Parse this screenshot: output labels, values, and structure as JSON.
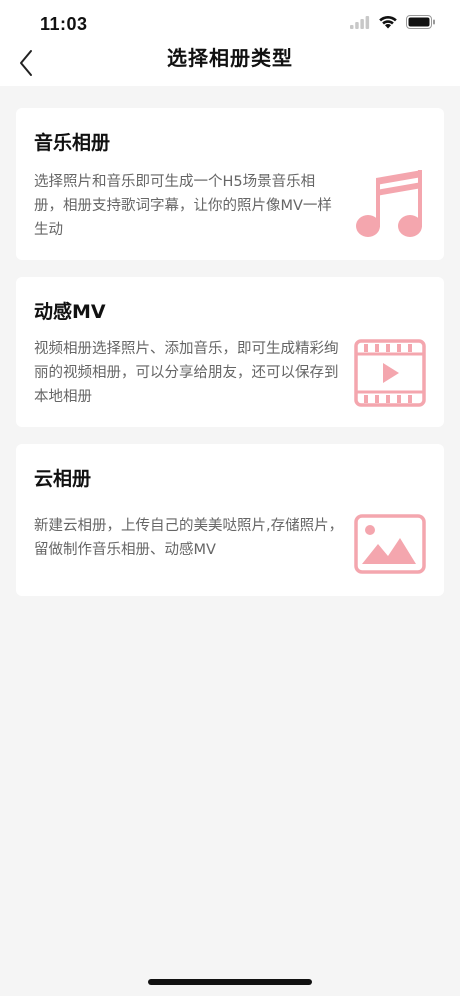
{
  "status_bar": {
    "time": "11:03"
  },
  "nav": {
    "title": "选择相册类型"
  },
  "cards": [
    {
      "title": "音乐相册",
      "description": "选择照片和音乐即可生成一个H5场景音乐相册，相册支持歌词字幕，让你的照片像MV一样生动",
      "icon": "music-note-icon"
    },
    {
      "title": "动感MV",
      "description": "视频相册选择照片、添加音乐，即可生成精彩绚丽的视频相册，可以分享给朋友，还可以保存到本地相册",
      "icon": "video-film-icon"
    },
    {
      "title": "云相册",
      "description": "新建云相册，上传自己的美美哒照片,存储照片，留做制作音乐相册、动感MV",
      "icon": "image-icon"
    }
  ],
  "colors": {
    "accent_pink": "#f4a6ae",
    "background": "#f5f5f5"
  }
}
